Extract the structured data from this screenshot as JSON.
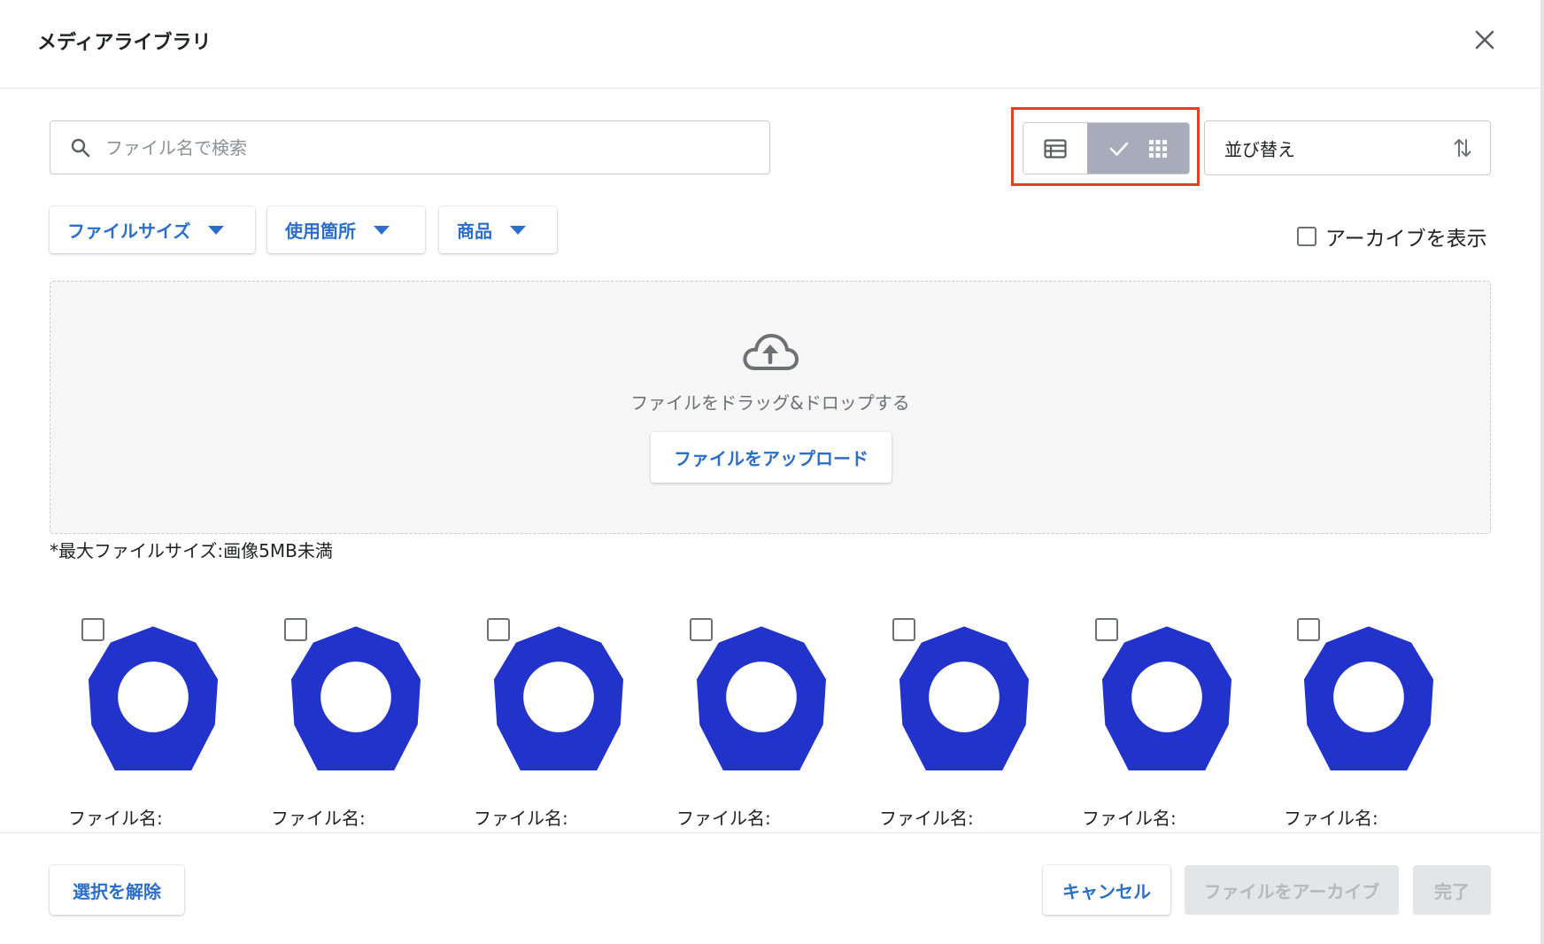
{
  "header": {
    "title": "メディアライブラリ"
  },
  "search": {
    "placeholder": "ファイル名で検索",
    "value": ""
  },
  "view_toggle": {
    "options": [
      "list",
      "grid"
    ],
    "selected": "grid"
  },
  "sort": {
    "label": "並び替え"
  },
  "filters": [
    {
      "label": "ファイルサイズ"
    },
    {
      "label": "使用箇所"
    },
    {
      "label": "商品"
    }
  ],
  "archive_toggle": {
    "label": "アーカイブを表示",
    "checked": false
  },
  "dropzone": {
    "text": "ファイルをドラッグ&ドロップする",
    "upload_label": "ファイルをアップロード"
  },
  "note": "*最大ファイルサイズ:画像5MB未満",
  "media": [
    {
      "filename_label": "ファイル名:",
      "checked": false
    },
    {
      "filename_label": "ファイル名:",
      "checked": false
    },
    {
      "filename_label": "ファイル名:",
      "checked": false
    },
    {
      "filename_label": "ファイル名:",
      "checked": false
    },
    {
      "filename_label": "ファイル名:",
      "checked": false
    },
    {
      "filename_label": "ファイル名:",
      "checked": false
    },
    {
      "filename_label": "ファイル名:",
      "checked": false
    }
  ],
  "footer": {
    "deselect_label": "選択を解除",
    "cancel_label": "キャンセル",
    "archive_label": "ファイルをアーカイブ",
    "done_label": "完了"
  },
  "colors": {
    "accent": "#2c6ecb",
    "thumbnail": "#2233cc",
    "highlight_box": "#e0402a",
    "selected_view": "#a7abba"
  }
}
